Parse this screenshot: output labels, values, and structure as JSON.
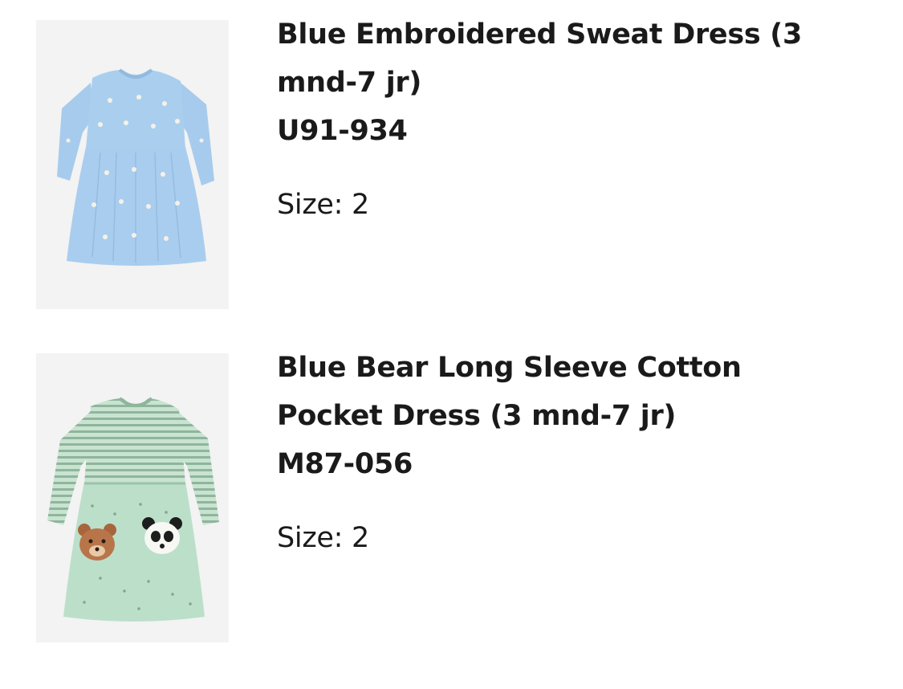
{
  "items": [
    {
      "title": "Blue Embroidered Sweat Dress (3 mnd-7 jr)",
      "code": "U91-934",
      "size": "Size: 2",
      "image_icon": "blue-dress-image"
    },
    {
      "title": "Blue Bear Long Sleeve Cotton Pocket Dress (3 mnd-7 jr)",
      "code": "M87-056",
      "size": "Size: 2",
      "image_icon": "green-bear-dress-image"
    }
  ],
  "colors": {
    "blue_dress": "#a9cdee",
    "green_dress": "#b9dcc6",
    "stripe": "#8fb59a",
    "bear": "#b8754a",
    "thumb_bg": "#f2f2f2"
  }
}
